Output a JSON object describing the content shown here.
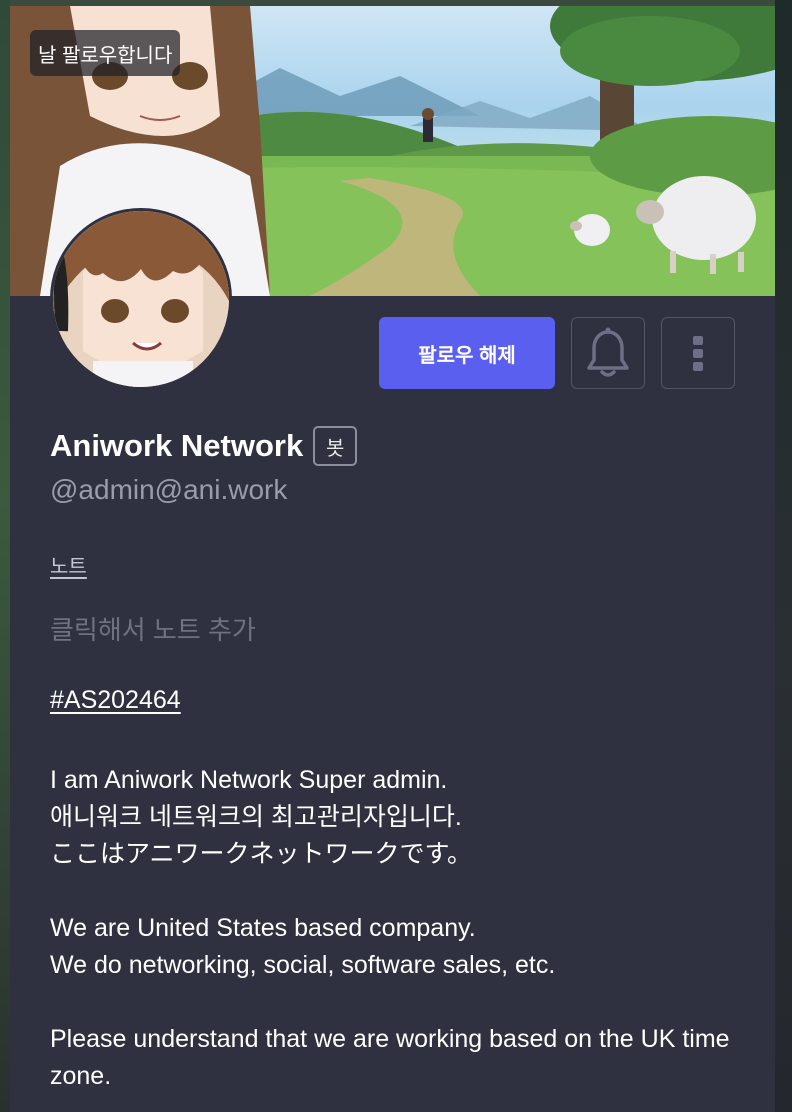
{
  "banner": {
    "follows_you_label": "날 팔로우합니다"
  },
  "actions": {
    "unfollow_label": "팔로우 해제",
    "notify_icon": "bell-icon",
    "more_icon": "more-vertical-icon"
  },
  "profile": {
    "display_name": "Aniwork Network",
    "bot_badge": "봇",
    "handle": "@admin@ani.work"
  },
  "note": {
    "label": "노트",
    "placeholder": "클릭해서 노트 추가"
  },
  "bio": {
    "hashtag": "#AS202464",
    "line1": "I am Aniwork Network Super admin.",
    "line2": "애니워크 네트워크의 최고관리자입니다.",
    "line3": "ここはアニワークネットワークです。",
    "line4": "We are United States based company.",
    "line5": "We do networking, social, software sales, etc.",
    "line6": "Please understand that we are working based on the UK time zone."
  },
  "colors": {
    "accent": "#5b5fef",
    "card_background": "#2f3040",
    "muted_text": "#9a9cae"
  }
}
